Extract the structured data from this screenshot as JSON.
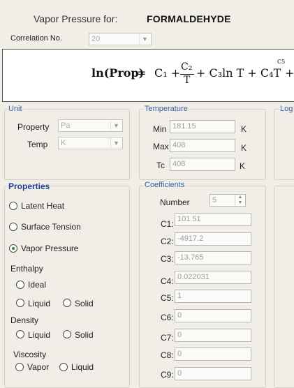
{
  "header": {
    "label": "Vapor Pressure for:",
    "compound": "FORMALDEHYDE"
  },
  "correlation": {
    "label": "Correlation No.",
    "value": "20"
  },
  "equation": {
    "lhs": "ln(Prop)",
    "equals": "=",
    "t1": "C₁ +",
    "num": "C₂",
    "den": "T",
    "t3": "+ C₃ln T + C₄T",
    "sup": "C5",
    "t4": "+"
  },
  "unit": {
    "title": "Unit",
    "property_label": "Property",
    "property_value": "Pa",
    "temp_label": "Temp",
    "temp_value": "K"
  },
  "temperature": {
    "title": "Temperature",
    "min_label": "Min",
    "min_value": "181.15",
    "min_unit": "K",
    "max_label": "Max",
    "max_value": "408",
    "max_unit": "K",
    "tc_label": "Tc",
    "tc_value": "408",
    "tc_unit": "K"
  },
  "log": {
    "title": "Log"
  },
  "properties": {
    "title": "Properties",
    "latent_heat": "Latent Heat",
    "surface_tension": "Surface Tension",
    "vapor_pressure": "Vapor Pressure",
    "enthalpy": "Enthalpy",
    "enthalpy_ideal": "Ideal",
    "enthalpy_liquid": "Liquid",
    "enthalpy_solid": "Solid",
    "density": "Density",
    "density_liquid": "Liquid",
    "density_solid": "Solid",
    "viscosity": "Viscosity",
    "viscosity_vapor": "Vapor",
    "viscosity_liquid": "Liquid",
    "selected": "Vapor Pressure"
  },
  "coefficients": {
    "title": "Coefficients",
    "number_label": "Number",
    "number_value": "5",
    "items": [
      {
        "label": "C1:",
        "value": "101.51"
      },
      {
        "label": "C2:",
        "value": "-4917.2"
      },
      {
        "label": "C3:",
        "value": "-13.765"
      },
      {
        "label": "C4:",
        "value": "0.022031"
      },
      {
        "label": "C5:",
        "value": "1"
      },
      {
        "label": "C6:",
        "value": "0"
      },
      {
        "label": "C7:",
        "value": "0"
      },
      {
        "label": "C8:",
        "value": "0"
      },
      {
        "label": "C9:",
        "value": "0"
      }
    ]
  }
}
